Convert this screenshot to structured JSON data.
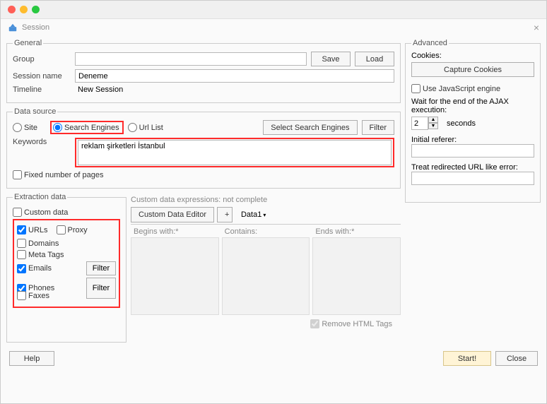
{
  "window": {
    "title": "Session"
  },
  "general": {
    "legend": "General",
    "group_label": "Group",
    "group_value": "",
    "save_label": "Save",
    "load_label": "Load",
    "session_name_label": "Session name",
    "session_name_value": "Deneme",
    "timeline_label": "Timeline",
    "timeline_value": "New Session"
  },
  "datasource": {
    "legend": "Data source",
    "site_label": "Site",
    "search_engines_label": "Search Engines",
    "url_list_label": "Url List",
    "select_se_label": "Select Search Engines",
    "filter_label": "Filter",
    "keywords_label": "Keywords",
    "keywords_value": "reklam şirketleri İstanbul",
    "fixed_pages_label": "Fixed number of pages"
  },
  "extraction": {
    "legend": "Extraction data",
    "custom_data": "Custom data",
    "urls": "URLs",
    "proxy": "Proxy",
    "domains": "Domains",
    "meta_tags": "Meta Tags",
    "emails": "Emails",
    "phones": "Phones",
    "faxes": "Faxes",
    "filter_btn": "Filter"
  },
  "custom": {
    "header": "Custom data expressions: not complete",
    "editor_btn": "Custom Data Editor",
    "plus": "+",
    "tab1": "Data1",
    "begins": "Begins with:*",
    "contains": "Contains:",
    "ends": "Ends with:*",
    "remove_html": "Remove HTML Tags"
  },
  "advanced": {
    "legend": "Advanced",
    "cookies_label": "Cookies:",
    "capture_btn": "Capture Cookies",
    "use_js": "Use JavaScript engine",
    "wait_ajax": "Wait for the end of the AJAX execution:",
    "seconds_value": "2",
    "seconds_label": "seconds",
    "initial_referer": "Initial referer:",
    "treat_redirect": "Treat redirected URL like error:"
  },
  "footer": {
    "help": "Help",
    "start": "Start!",
    "close": "Close"
  }
}
